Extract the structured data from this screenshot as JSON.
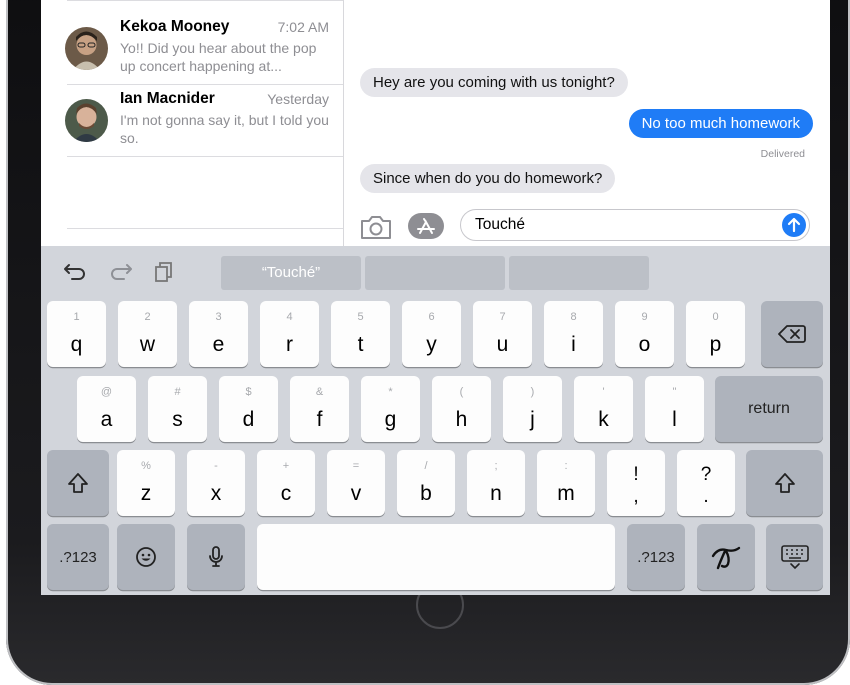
{
  "conversations": [
    {
      "name": "Kekoa Mooney",
      "time": "7:02 AM",
      "preview": "Yo!! Did you hear about the pop up concert happening at..."
    },
    {
      "name": "Ian Macnider",
      "time": "Yesterday",
      "preview": "I'm not gonna say it, but I told you so."
    }
  ],
  "messages": [
    {
      "direction": "incoming",
      "text": "Hey are you coming with us tonight?"
    },
    {
      "direction": "outgoing",
      "text": "No too much homework"
    },
    {
      "direction": "incoming",
      "text": "Since when do you do homework?"
    }
  ],
  "delivered_label": "Delivered",
  "compose": {
    "value": "Touché"
  },
  "keyboard": {
    "prediction": "“Touché”",
    "row1": [
      {
        "hint": "1",
        "key": "q"
      },
      {
        "hint": "2",
        "key": "w"
      },
      {
        "hint": "3",
        "key": "e"
      },
      {
        "hint": "4",
        "key": "r"
      },
      {
        "hint": "5",
        "key": "t"
      },
      {
        "hint": "6",
        "key": "y"
      },
      {
        "hint": "7",
        "key": "u"
      },
      {
        "hint": "8",
        "key": "i"
      },
      {
        "hint": "9",
        "key": "o"
      },
      {
        "hint": "0",
        "key": "p"
      }
    ],
    "row2": [
      {
        "hint": "@",
        "key": "a"
      },
      {
        "hint": "#",
        "key": "s"
      },
      {
        "hint": "$",
        "key": "d"
      },
      {
        "hint": "&",
        "key": "f"
      },
      {
        "hint": "*",
        "key": "g"
      },
      {
        "hint": "(",
        "key": "h"
      },
      {
        "hint": ")",
        "key": "j"
      },
      {
        "hint": "'",
        "key": "k"
      },
      {
        "hint": "\"",
        "key": "l"
      }
    ],
    "row3": [
      {
        "hint": "%",
        "key": "z"
      },
      {
        "hint": "-",
        "key": "x"
      },
      {
        "hint": "+",
        "key": "c"
      },
      {
        "hint": "=",
        "key": "v"
      },
      {
        "hint": "/",
        "key": "b"
      },
      {
        "hint": ";",
        "key": "n"
      },
      {
        "hint": ":",
        "key": "m"
      },
      {
        "hint": "!",
        "key": ","
      },
      {
        "hint": "?",
        "key": "."
      }
    ],
    "return_label": "return",
    "numbers_label": ".?123"
  },
  "icons": {
    "undo": "undo-icon",
    "redo": "redo-icon",
    "paste": "paste-icon",
    "camera": "camera-icon",
    "apps": "app-store-icon",
    "send": "send-arrow-icon",
    "backspace": "backspace-icon",
    "shift": "shift-icon",
    "emoji": "emoji-icon",
    "mic": "microphone-icon",
    "handwriting": "handwriting-icon",
    "dismiss": "keyboard-dismiss-icon"
  },
  "colors": {
    "accent": "#1f7cf6",
    "incoming_bubble": "#e5e5ea",
    "keyboard_bg": "#d2d5db"
  }
}
